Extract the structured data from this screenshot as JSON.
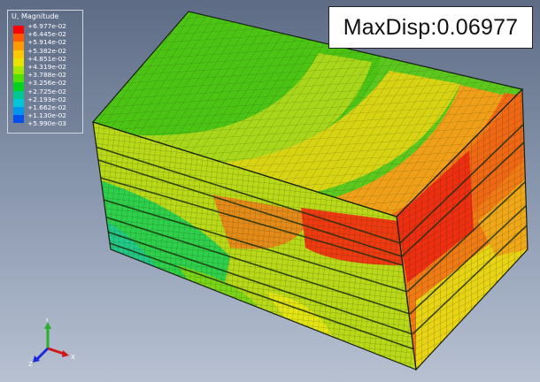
{
  "legend": {
    "title": "U, Magnitude",
    "values": [
      "+6.977e-02",
      "+6.445e-02",
      "+5.914e-02",
      "+5.382e-02",
      "+4.851e-02",
      "+4.319e-02",
      "+3.788e-02",
      "+3.256e-02",
      "+2.725e-02",
      "+2.193e-02",
      "+1.662e-02",
      "+1.130e-02",
      "+5.990e-03"
    ],
    "colors": [
      "#ff0000",
      "#ff5a00",
      "#ff9b00",
      "#ffc800",
      "#e8e400",
      "#a6e600",
      "#4fe000",
      "#00d21e",
      "#00c890",
      "#00c8d8",
      "#0096f0",
      "#0050f0"
    ]
  },
  "annotation": {
    "text": "MaxDisp:0.06977"
  },
  "triad": {
    "x_label": "X",
    "y_label": "Y",
    "z_label": "Z"
  },
  "model": {
    "mesh_color": "#1a2a10"
  }
}
